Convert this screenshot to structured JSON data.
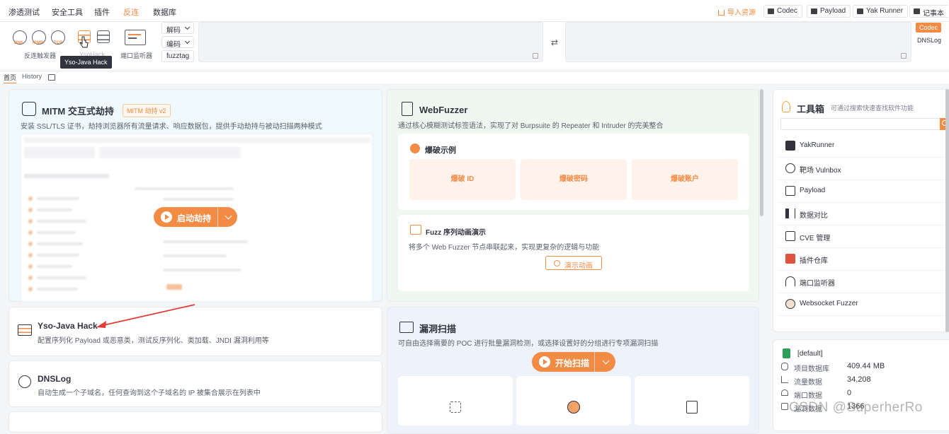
{
  "top_menu": [
    "渗透测试",
    "安全工具",
    "插件",
    "反连",
    "数据库"
  ],
  "top_right": {
    "import": "导入资源",
    "codec": "Codec",
    "payload": "Payload",
    "yak_runner": "Yak Runner",
    "notes": "记事本"
  },
  "toolbar": {
    "reverse_icons": [
      "DNS",
      "ICMP",
      "TCP"
    ],
    "reverse_group": "反连触发器",
    "yso_group": "YsoHack",
    "port_group": "端口监听器",
    "decode": "解码",
    "encode": "编码",
    "fuzztag": "fuzztag",
    "right_codec": "Codec",
    "right_dnslog": "DNSLog"
  },
  "tooltip": "Yso-Java Hack",
  "page_tabs": [
    "首页",
    "History"
  ],
  "mitm": {
    "title": "MITM 交互式劫持",
    "tag": "MITM 劫持 v2",
    "desc": "安装 SSL/TLS 证书，劫持浏览器所有流量请求、响应数据包，提供手动劫持与被动扫描两种模式",
    "button": "启动劫持"
  },
  "yso": {
    "title": "Yso-Java Hack",
    "desc": "配置序列化 Payload 或恶意类，测试反序列化、类加载、JNDI 漏洞利用等"
  },
  "dnslog": {
    "title": "DNSLog",
    "desc": "自动生成一个子域名，任何查询到这个子域名的 IP 被集合展示在列表中"
  },
  "webfuzzer": {
    "title": "WebFuzzer",
    "desc": "通过核心模糊测试标签语法，实现了对 Burpsuite 的 Repeater 和 Intruder 的完美整合",
    "examples_title": "爆破示例",
    "examples": [
      "爆破 ID",
      "爆破密码",
      "爆破账户"
    ],
    "seq_title": "Fuzz 序列动画演示",
    "seq_desc": "将多个 Web Fuzzer 节点串联起来，实现更复杂的逻辑与功能",
    "seq_button": "演示动画"
  },
  "vuln_scan": {
    "title": "漏洞扫描",
    "desc": "可自由选择需要的 POC 进行批量漏洞检测，或选择设置好的分组进行专项漏洞扫描",
    "button": "开始扫描"
  },
  "toolbox": {
    "title": "工具箱",
    "subtitle": "可通过搜索快速查找软件功能",
    "items": [
      "YakRunner",
      "靶场 Vulnbox",
      "Payload",
      "数据对比",
      "CVE 管理",
      "插件仓库",
      "端口监听器",
      "Websocket Fuzzer"
    ]
  },
  "project": {
    "name": "[default]",
    "stats": [
      {
        "label": "项目数据库",
        "value": "409.44 MB"
      },
      {
        "label": "流量数据",
        "value": "34,208"
      },
      {
        "label": "端口数据",
        "value": "0"
      },
      {
        "label": "漏洞数据",
        "value": "1366"
      }
    ]
  },
  "watermark": "CSDN @SuperherRo",
  "colors": {
    "accent": "#f28b44",
    "arrow": "#e53935"
  }
}
